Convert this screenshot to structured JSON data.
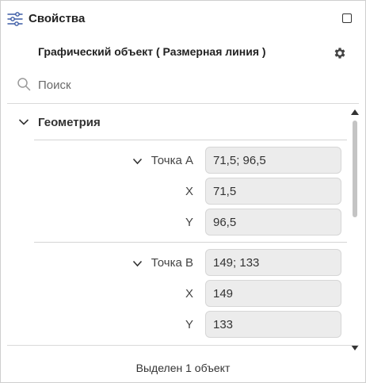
{
  "panel": {
    "title": "Свойства",
    "icons": {
      "panel": "sliders-icon",
      "maximize": "maximize-icon",
      "settings": "gear-icon",
      "search": "search-icon"
    }
  },
  "object_title": "Графический объект ( Размерная линия )",
  "search": {
    "placeholder": "Поиск",
    "value": ""
  },
  "group": {
    "label": "Геометрия",
    "expanded": true
  },
  "properties": [
    {
      "label": "Точка A",
      "value": "71,5; 96,5",
      "expandable": true
    },
    {
      "label": "X",
      "value": "71,5",
      "expandable": false
    },
    {
      "label": "Y",
      "value": "96,5",
      "expandable": false
    },
    {
      "label": "Точка B",
      "value": "149; 133",
      "expandable": true
    },
    {
      "label": "X",
      "value": "149",
      "expandable": false
    },
    {
      "label": "Y",
      "value": "133",
      "expandable": false
    }
  ],
  "status": "Выделен 1 объект",
  "colors": {
    "field_bg": "#ececec",
    "border": "#cfcfcf",
    "scroll_thumb": "#c4c4c4"
  }
}
